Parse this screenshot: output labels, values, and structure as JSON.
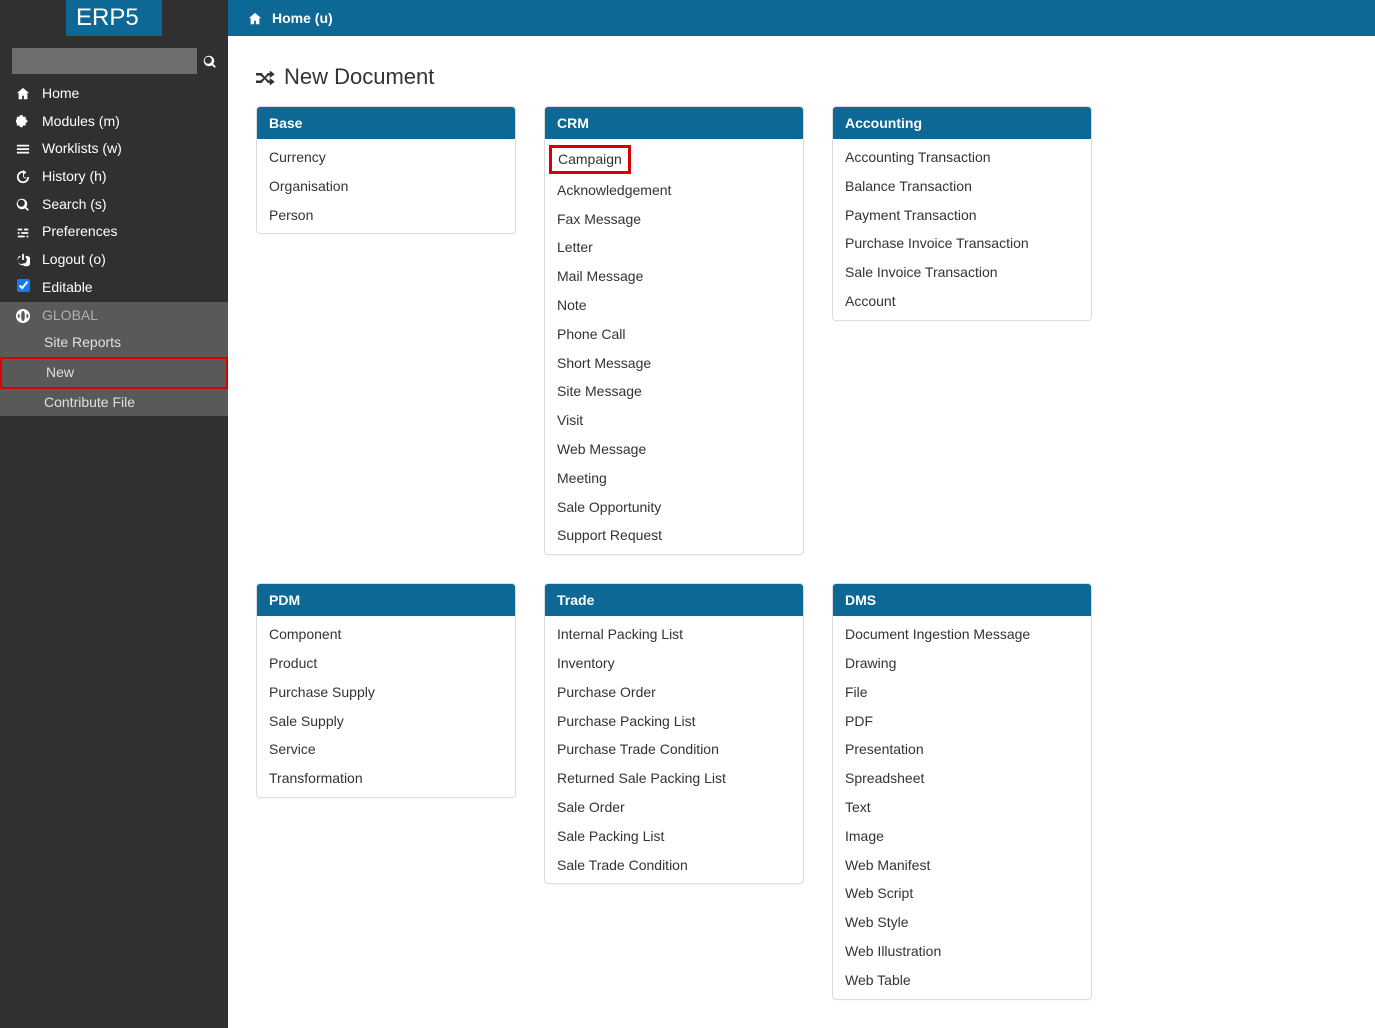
{
  "logo": "ERP5",
  "search": {
    "placeholder": ""
  },
  "sidebar": {
    "items": [
      {
        "id": "home",
        "icon": "home",
        "label": "Home"
      },
      {
        "id": "modules",
        "icon": "puzzle",
        "label": "Modules (m)"
      },
      {
        "id": "worklists",
        "icon": "list",
        "label": "Worklists (w)"
      },
      {
        "id": "history",
        "icon": "history",
        "label": "History (h)"
      },
      {
        "id": "search",
        "icon": "search",
        "label": "Search (s)"
      },
      {
        "id": "preferences",
        "icon": "sliders",
        "label": "Preferences"
      },
      {
        "id": "logout",
        "icon": "power",
        "label": "Logout (o)"
      },
      {
        "id": "editable",
        "icon": "checkbox",
        "label": "Editable",
        "checked": true
      },
      {
        "id": "global",
        "icon": "globe",
        "label": "GLOBAL",
        "section": true
      },
      {
        "id": "site-reports",
        "label": "Site Reports",
        "sub": true
      },
      {
        "id": "new",
        "label": "New",
        "sub": true,
        "highlight": true
      },
      {
        "id": "contribute-file",
        "label": "Contribute File",
        "sub": true
      }
    ]
  },
  "breadcrumb": {
    "label": "Home (u)"
  },
  "page": {
    "title": "New Document"
  },
  "categories": [
    {
      "id": "base",
      "title": "Base",
      "items": [
        {
          "label": "Currency"
        },
        {
          "label": "Organisation"
        },
        {
          "label": "Person"
        }
      ]
    },
    {
      "id": "crm",
      "title": "CRM",
      "items": [
        {
          "label": "Campaign",
          "highlight": true
        },
        {
          "label": "Acknowledgement"
        },
        {
          "label": "Fax Message"
        },
        {
          "label": "Letter"
        },
        {
          "label": "Mail Message"
        },
        {
          "label": "Note"
        },
        {
          "label": "Phone Call"
        },
        {
          "label": "Short Message"
        },
        {
          "label": "Site Message"
        },
        {
          "label": "Visit"
        },
        {
          "label": "Web Message"
        },
        {
          "label": "Meeting"
        },
        {
          "label": "Sale Opportunity"
        },
        {
          "label": "Support Request"
        }
      ]
    },
    {
      "id": "accounting",
      "title": "Accounting",
      "items": [
        {
          "label": "Accounting Transaction"
        },
        {
          "label": "Balance Transaction"
        },
        {
          "label": "Payment Transaction"
        },
        {
          "label": "Purchase Invoice Transaction"
        },
        {
          "label": "Sale Invoice Transaction"
        },
        {
          "label": "Account"
        }
      ]
    },
    {
      "id": "pdm",
      "title": "PDM",
      "items": [
        {
          "label": "Component"
        },
        {
          "label": "Product"
        },
        {
          "label": "Purchase Supply"
        },
        {
          "label": "Sale Supply"
        },
        {
          "label": "Service"
        },
        {
          "label": "Transformation"
        }
      ]
    },
    {
      "id": "trade",
      "title": "Trade",
      "items": [
        {
          "label": "Internal Packing List"
        },
        {
          "label": "Inventory"
        },
        {
          "label": "Purchase Order"
        },
        {
          "label": "Purchase Packing List"
        },
        {
          "label": "Purchase Trade Condition"
        },
        {
          "label": "Returned Sale Packing List"
        },
        {
          "label": "Sale Order"
        },
        {
          "label": "Sale Packing List"
        },
        {
          "label": "Sale Trade Condition"
        }
      ]
    },
    {
      "id": "dms",
      "title": "DMS",
      "items": [
        {
          "label": "Document Ingestion Message"
        },
        {
          "label": "Drawing"
        },
        {
          "label": "File"
        },
        {
          "label": "PDF"
        },
        {
          "label": "Presentation"
        },
        {
          "label": "Spreadsheet"
        },
        {
          "label": "Text"
        },
        {
          "label": "Image"
        },
        {
          "label": "Web Manifest"
        },
        {
          "label": "Web Script"
        },
        {
          "label": "Web Style"
        },
        {
          "label": "Web Illustration"
        },
        {
          "label": "Web Table"
        }
      ]
    }
  ]
}
